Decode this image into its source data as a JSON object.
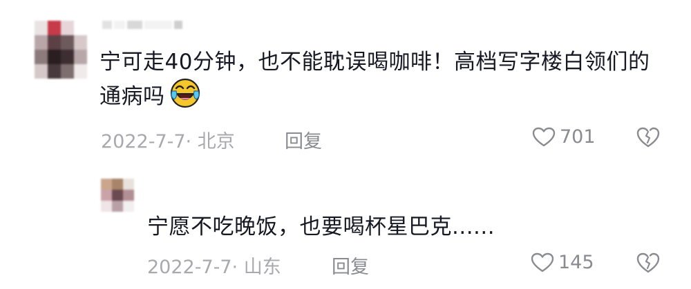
{
  "comment": {
    "text": "宁可走40分钟，也不能耽误喝咖啡！高档写字楼白领们的通病吗",
    "emoji": "laughing-crying-emoji",
    "date_location": "2022-7-7· 北京",
    "reply_label": "回复",
    "likes": "701"
  },
  "reply": {
    "text": "宁愿不吃晚饭，也要喝杯星巴克......",
    "date_location": "2022-7-7· 山东",
    "reply_label": "回复",
    "likes": "145"
  },
  "colors": {
    "text": "#161823",
    "meta": "#a8a9ad",
    "icon": "#8a8b90"
  }
}
